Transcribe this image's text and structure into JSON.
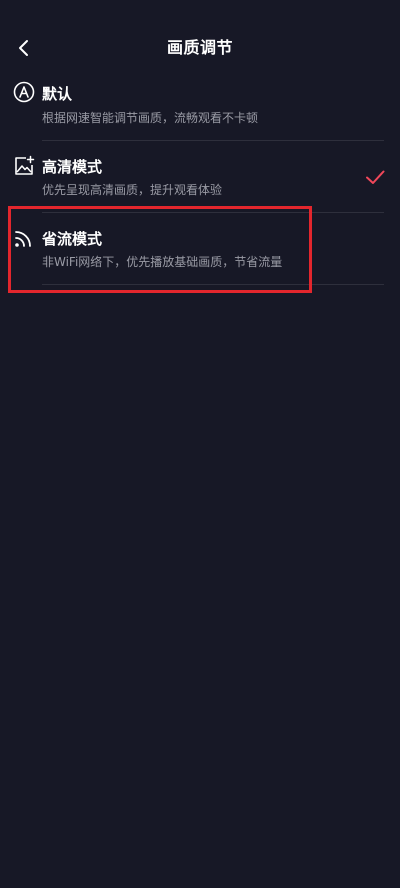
{
  "header": {
    "title": "画质调节",
    "back_icon": "chevron-left-icon"
  },
  "options": [
    {
      "id": "default",
      "title": "默认",
      "description": "根据网速智能调节画质，流畅观看不卡顿",
      "icon": "auto-a-icon",
      "selected": false
    },
    {
      "id": "hd",
      "title": "高清模式",
      "description": "优先呈现高清画质，提升观看体验",
      "icon": "image-sparkle-icon",
      "selected": true
    },
    {
      "id": "saver",
      "title": "省流模式",
      "description": "非WiFi网络下，优先播放基础画质，节省流量",
      "icon": "signal-wave-icon",
      "selected": false,
      "highlighted": true
    }
  ],
  "colors": {
    "background": "#171826",
    "check": "#f0475a",
    "highlight": "#e3262d",
    "description": "#9a9ba5"
  }
}
